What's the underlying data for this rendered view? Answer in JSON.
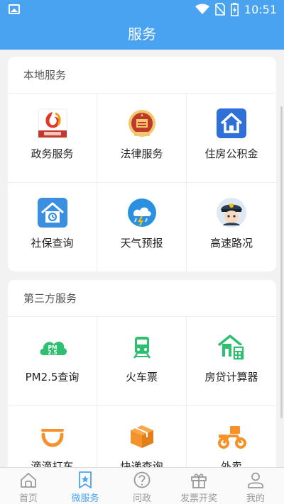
{
  "status": {
    "time": "10:51"
  },
  "header": {
    "title": "服务"
  },
  "local_services": {
    "title": "本地服务",
    "items": [
      {
        "label": "政务服务",
        "icon": "government-affairs-icon"
      },
      {
        "label": "法律服务",
        "icon": "legal-emblem-icon"
      },
      {
        "label": "住房公积金",
        "icon": "housing-fund-icon"
      },
      {
        "label": "社保查询",
        "icon": "social-security-icon"
      },
      {
        "label": "天气预报",
        "icon": "weather-icon"
      },
      {
        "label": "高速路况",
        "icon": "traffic-police-icon"
      }
    ]
  },
  "third_party_services": {
    "title": "第三方服务",
    "items": [
      {
        "label": "PM2.5查询",
        "icon": "pm25-cloud-icon",
        "icon_text": "PM\n2.5"
      },
      {
        "label": "火车票",
        "icon": "train-icon"
      },
      {
        "label": "房贷计算器",
        "icon": "mortgage-calculator-icon"
      },
      {
        "label": "滴滴打车",
        "icon": "didi-icon"
      },
      {
        "label": "快递查询",
        "icon": "package-icon"
      },
      {
        "label": "外卖",
        "icon": "delivery-scooter-icon"
      }
    ]
  },
  "tabbar": {
    "tabs": [
      {
        "label": "首页",
        "icon": "home-icon"
      },
      {
        "label": "微服务",
        "icon": "star-bookmark-icon",
        "active": true
      },
      {
        "label": "问政",
        "icon": "question-icon"
      },
      {
        "label": "发票开奖",
        "icon": "gift-icon"
      },
      {
        "label": "我的",
        "icon": "profile-icon"
      }
    ]
  },
  "colors": {
    "primary": "#4aa3f0",
    "green": "#2fbf71",
    "orange": "#f5922b"
  }
}
